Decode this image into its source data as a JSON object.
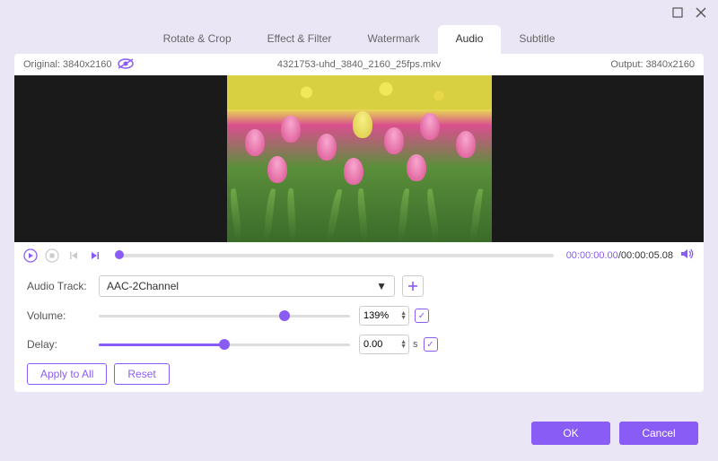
{
  "tabs": {
    "rotate": "Rotate & Crop",
    "effect": "Effect & Filter",
    "watermark": "Watermark",
    "audio": "Audio",
    "subtitle": "Subtitle"
  },
  "info": {
    "original_label": "Original: 3840x2160",
    "filename": "4321753-uhd_3840_2160_25fps.mkv",
    "output_label": "Output: 3840x2160"
  },
  "playback": {
    "current": "00:00:00.00",
    "sep": "/",
    "duration": "00:00:05.08"
  },
  "form": {
    "audio_track_label": "Audio Track:",
    "audio_track_value": "AAC-2Channel",
    "volume_label": "Volume:",
    "volume_value": "139%",
    "volume_fill": "74",
    "delay_label": "Delay:",
    "delay_value": "0.00",
    "delay_unit": "s",
    "delay_fill": "50"
  },
  "buttons": {
    "apply_all": "Apply to All",
    "reset": "Reset",
    "ok": "OK",
    "cancel": "Cancel"
  }
}
